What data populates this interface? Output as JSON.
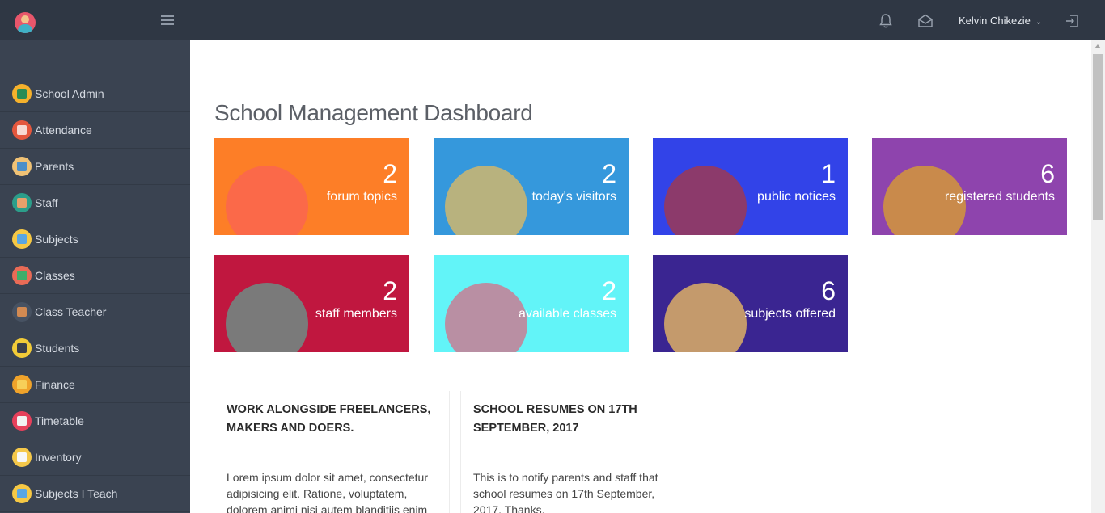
{
  "header": {
    "user_name": "Kelvin Chikezie",
    "icons": [
      "school-logo-icon",
      "hamburger-icon",
      "bell-icon",
      "envelope-icon",
      "chevron-down-icon",
      "logout-icon"
    ]
  },
  "sidebar": {
    "items": [
      {
        "label": "School Admin",
        "icon": "school-admin-icon",
        "color": "#f5b12c",
        "inner": "#2a8c55"
      },
      {
        "label": "Attendance",
        "icon": "attendance-icon",
        "color": "#e4573d",
        "inner": "#f7d9d2"
      },
      {
        "label": "Parents",
        "icon": "parents-icon",
        "color": "#f0c275",
        "inner": "#4c8fc9"
      },
      {
        "label": "Staff",
        "icon": "staff-icon",
        "color": "#2c9e8a",
        "inner": "#e8a06b"
      },
      {
        "label": "Subjects",
        "icon": "subjects-icon",
        "color": "#f6c844",
        "inner": "#5aa6e2"
      },
      {
        "label": "Classes",
        "icon": "classes-icon",
        "color": "#e96b56",
        "inner": "#3fae6a"
      },
      {
        "label": "Class Teacher",
        "icon": "class-teacher-icon",
        "color": "#475262",
        "inner": "#d28a52"
      },
      {
        "label": "Students",
        "icon": "students-icon",
        "color": "#f2cb38",
        "inner": "#3b3f4a"
      },
      {
        "label": "Finance",
        "icon": "finance-icon",
        "color": "#f0a32a",
        "inner": "#f7cf58"
      },
      {
        "label": "Timetable",
        "icon": "timetable-icon",
        "color": "#e6405b",
        "inner": "#f2f2f2"
      },
      {
        "label": "Inventory",
        "icon": "inventory-icon",
        "color": "#f5c84a",
        "inner": "#f7f7f7"
      },
      {
        "label": "Subjects I Teach",
        "icon": "subjects-i-teach-icon",
        "color": "#f6c844",
        "inner": "#5aa6e2"
      }
    ]
  },
  "main": {
    "title": "School Management Dashboard",
    "cards": [
      {
        "value": "2",
        "label": "forum topics",
        "icon": "speaking-head-icon",
        "bg": "#fd7e27",
        "circle": "#fb6949"
      },
      {
        "value": "2",
        "label": "today's visitors",
        "icon": "id-badge-icon",
        "bg": "#3598dc",
        "circle": "#b8b27e"
      },
      {
        "value": "1",
        "label": "public notices",
        "icon": "megaphone-icon",
        "bg": "#3243e8",
        "circle": "#8c3a6b"
      },
      {
        "value": "6",
        "label": "registered students",
        "icon": "student-avatar-icon",
        "bg": "#8e44ad",
        "circle": "#c98a4b"
      },
      {
        "value": "2",
        "label": "staff members",
        "icon": "staff-avatar-icon",
        "bg": "#c0173f",
        "circle": "#7a7a7a"
      },
      {
        "value": "2",
        "label": "available classes",
        "icon": "chalkboard-icon",
        "bg": "#62f4f8",
        "circle": "#b98fa3"
      },
      {
        "value": "6",
        "label": "subjects offered",
        "icon": "notebook-pencil-icon",
        "bg": "#3a2591",
        "circle": "#c49a6c"
      }
    ],
    "notices": [
      {
        "title": "WORK ALONGSIDE FREELANCERS, MAKERS AND DOERS.",
        "body": "Lorem ipsum dolor sit amet, consectetur adipisicing elit. Ratione, voluptatem, dolorem animi nisi autem blanditiis enim culpa reiciendis et"
      },
      {
        "title": "SCHOOL RESUMES ON 17TH SEPTEMBER, 2017",
        "body": "This is to notify parents and staff that school resumes on 17th September, 2017. Thanks."
      }
    ]
  }
}
